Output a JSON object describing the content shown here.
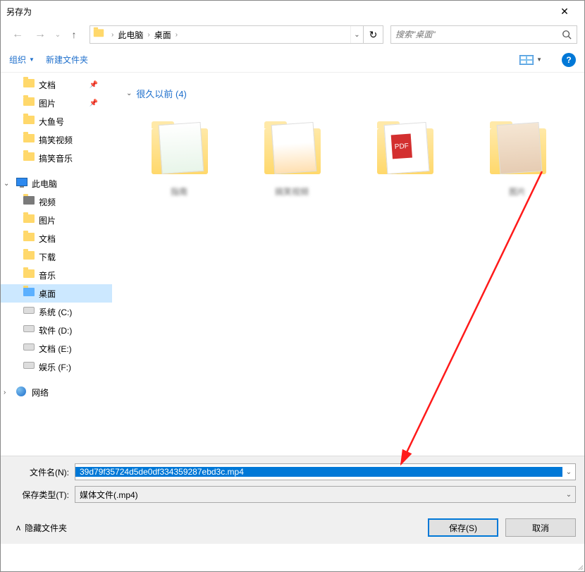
{
  "window": {
    "title": "另存为"
  },
  "breadcrumb": {
    "pc": "此电脑",
    "location": "桌面"
  },
  "search": {
    "placeholder": "搜索\"桌面\""
  },
  "toolbar": {
    "organize": "组织",
    "newfolder": "新建文件夹"
  },
  "sidebar_quick": [
    {
      "label": "文档",
      "pinned": true
    },
    {
      "label": "图片",
      "pinned": true
    },
    {
      "label": "大鱼号"
    },
    {
      "label": "搞笑视频"
    },
    {
      "label": "搞笑音乐"
    }
  ],
  "sidebar_thispc_label": "此电脑",
  "sidebar_thispc": [
    {
      "label": "视频",
      "type": "lib"
    },
    {
      "label": "图片",
      "type": "lib"
    },
    {
      "label": "文档",
      "type": "lib"
    },
    {
      "label": "下载",
      "type": "lib"
    },
    {
      "label": "音乐",
      "type": "lib"
    },
    {
      "label": "桌面",
      "type": "lib",
      "selected": true
    },
    {
      "label": "系统 (C:)",
      "type": "drive"
    },
    {
      "label": "软件 (D:)",
      "type": "drive"
    },
    {
      "label": "文档 (E:)",
      "type": "drive"
    },
    {
      "label": "娱乐 (F:)",
      "type": "drive"
    }
  ],
  "sidebar_network_label": "网络",
  "content": {
    "group_label": "很久以前 (4)",
    "items": [
      "    指南",
      "搞笑视频",
      "        ",
      "    图片"
    ]
  },
  "form": {
    "filename_label": "文件名(N):",
    "filename_value": "39d79f35724d5de0df334359287ebd3c.mp4",
    "filetype_label": "保存类型(T):",
    "filetype_value": "媒体文件(.mp4)"
  },
  "footer": {
    "hide_folders": "隐藏文件夹",
    "save": "保存(S)",
    "cancel": "取消"
  }
}
